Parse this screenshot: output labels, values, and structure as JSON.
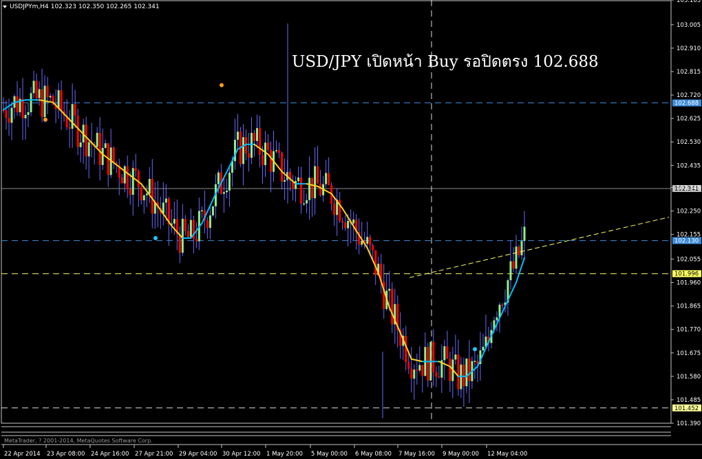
{
  "header": {
    "symbol": "USDJPYm,H4",
    "open": "102.323",
    "high": "102.350",
    "low": "102.265",
    "close": "102.341"
  },
  "copyright": "MetaTrader, ? 2001-2014, MetaQuotes Software Corp.",
  "annotation": "USD/JPY เปิดหน้า Buy รอปิดตรง 102.688",
  "colors": {
    "background": "#000000",
    "bull": "#90ee90",
    "bear": "#ff0000",
    "wick_bull": "#6a6aff",
    "wick_bear": "#6a6aff",
    "ma_up": "#00bfff",
    "ma_down": "#ffd21f",
    "level_blue": "#3d8bd9",
    "level_yellow": "#ffff66"
  },
  "chart_data": {
    "type": "candlestick",
    "symbol": "USDJPYm",
    "timeframe": "H4",
    "ylim": [
      101.39,
      103.105
    ],
    "y_ticks": [
      "103.105",
      "103.005",
      "102.910",
      "102.815",
      "102.720",
      "102.625",
      "102.530",
      "102.435",
      "102.345",
      "102.250",
      "102.155",
      "102.055",
      "101.960",
      "101.865",
      "101.770",
      "101.675",
      "101.580",
      "101.485",
      "101.390"
    ],
    "x_ticks": [
      "22 Apr 2014",
      "23 Apr 08:00",
      "24 Apr 16:00",
      "27 Apr 21:00",
      "29 Apr 04:00",
      "30 Apr 12:00",
      "1 May 20:00",
      "5 May 00:00",
      "6 May 08:00",
      "7 May 16:00",
      "9 May 00:00",
      "12 May 04:00"
    ],
    "levels": [
      {
        "price": 102.688,
        "label": "102.688",
        "style": "dashed-blue"
      },
      {
        "price": 102.341,
        "label": "102.341",
        "style": "solid-gray"
      },
      {
        "price": 102.13,
        "label": "102.130",
        "style": "dashed-blue"
      },
      {
        "price": 101.996,
        "label": "101.996",
        "style": "dashed-yellow"
      },
      {
        "price": 101.452,
        "label": "101.452",
        "style": "dashed-white"
      }
    ],
    "trendline": {
      "from": [
        101.98,
        "7 May 16:00"
      ],
      "to": [
        102.225,
        "after 12 May"
      ]
    },
    "vline_date": "7 May 16:00",
    "dots": [
      {
        "price": 102.76,
        "color": "orange",
        "near": "29 Apr 04:00"
      },
      {
        "price": 102.62,
        "color": "orange",
        "near": "22 Apr 2014"
      },
      {
        "price": 102.14,
        "color": "cyan",
        "near": "27 Apr 21:00"
      },
      {
        "price": 101.69,
        "color": "cyan",
        "near": "12 May 04:00"
      }
    ],
    "ma_points": [
      [
        102.66,
        0
      ],
      [
        102.69,
        4
      ],
      [
        102.7,
        8
      ],
      [
        102.7,
        13
      ],
      [
        102.69,
        18
      ],
      [
        102.62,
        24
      ],
      [
        102.55,
        30
      ],
      [
        102.48,
        36
      ],
      [
        102.42,
        43
      ],
      [
        102.36,
        50
      ],
      [
        102.27,
        56
      ],
      [
        102.19,
        61
      ],
      [
        102.14,
        65
      ],
      [
        102.14,
        68
      ],
      [
        102.2,
        72
      ],
      [
        102.32,
        77
      ],
      [
        102.43,
        82
      ],
      [
        102.5,
        85
      ],
      [
        102.52,
        88
      ],
      [
        102.52,
        91
      ],
      [
        102.48,
        96
      ],
      [
        102.41,
        101
      ],
      [
        102.36,
        106
      ],
      [
        102.36,
        110
      ],
      [
        102.35,
        114
      ],
      [
        102.32,
        119
      ],
      [
        102.26,
        123
      ],
      [
        102.17,
        128
      ],
      [
        102.1,
        132
      ],
      [
        102.0,
        136
      ],
      [
        101.86,
        140
      ],
      [
        101.73,
        145
      ],
      [
        101.65,
        148
      ],
      [
        101.64,
        152
      ],
      [
        101.64,
        158
      ],
      [
        101.62,
        162
      ],
      [
        101.58,
        165
      ],
      [
        101.58,
        168
      ],
      [
        101.62,
        172
      ],
      [
        101.72,
        176
      ],
      [
        101.84,
        181
      ],
      [
        101.96,
        186
      ],
      [
        102.06,
        189
      ]
    ]
  }
}
